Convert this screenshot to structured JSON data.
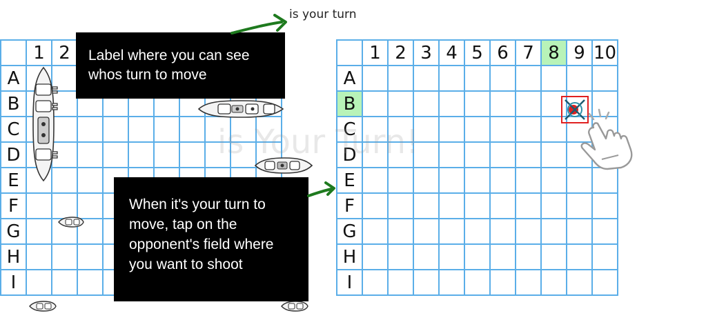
{
  "turn_label": "is your turn",
  "watermark": "is Your Turn!",
  "columns": [
    "1",
    "2",
    "3",
    "4",
    "5",
    "6",
    "7",
    "8",
    "9",
    "10"
  ],
  "rows": [
    "A",
    "B",
    "C",
    "D",
    "E",
    "F",
    "G",
    "H",
    "I"
  ],
  "callouts": {
    "turn_label_hint": "Label where you can see whos turn to move",
    "shoot_hint": "When it's your turn to move, tap on the opponent's field where you want to shoot"
  },
  "opponent_board": {
    "highlighted_column": "8",
    "highlighted_row": "B",
    "target_cell": "B8"
  },
  "player_board": {
    "ships": [
      {
        "name": "vertical-ship-4",
        "cells": [
          "A1",
          "B1",
          "C1",
          "D1"
        ]
      },
      {
        "name": "horizontal-ship-3",
        "cells": [
          "B8",
          "B9",
          "B10"
        ]
      },
      {
        "name": "horizontal-ship-2",
        "cells": [
          "D9",
          "D10"
        ]
      },
      {
        "name": "small-ship-f2",
        "cells": [
          "F2"
        ]
      },
      {
        "name": "small-ship-i1",
        "cells": [
          "I1"
        ]
      },
      {
        "name": "small-ship-i10",
        "cells": [
          "I10"
        ]
      }
    ]
  },
  "colors": {
    "grid_line": "#5aaee8",
    "highlight": "#b8f3b8",
    "arrow": "#1e7a1e",
    "callout_bg": "#000000",
    "target_marker": "#e02020"
  },
  "icons": [
    "tap-hand-icon",
    "crosshair-target-icon",
    "arrow-icon"
  ]
}
